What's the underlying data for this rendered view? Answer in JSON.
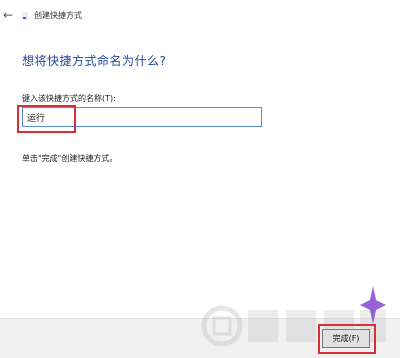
{
  "window": {
    "title": "创建快捷方式",
    "back_icon": "arrow-left-icon"
  },
  "main": {
    "heading": "想将快捷方式命名为什么?",
    "field_label": "键入该快捷方式的名称(T):",
    "name_value": "运行",
    "hint": "单击\"完成\"创建快捷方式。"
  },
  "footer": {
    "finish_label": "完成(F)"
  },
  "colors": {
    "heading": "#1e4a9c",
    "highlight": "#d62f3a",
    "input_border": "#5a8fd6"
  }
}
